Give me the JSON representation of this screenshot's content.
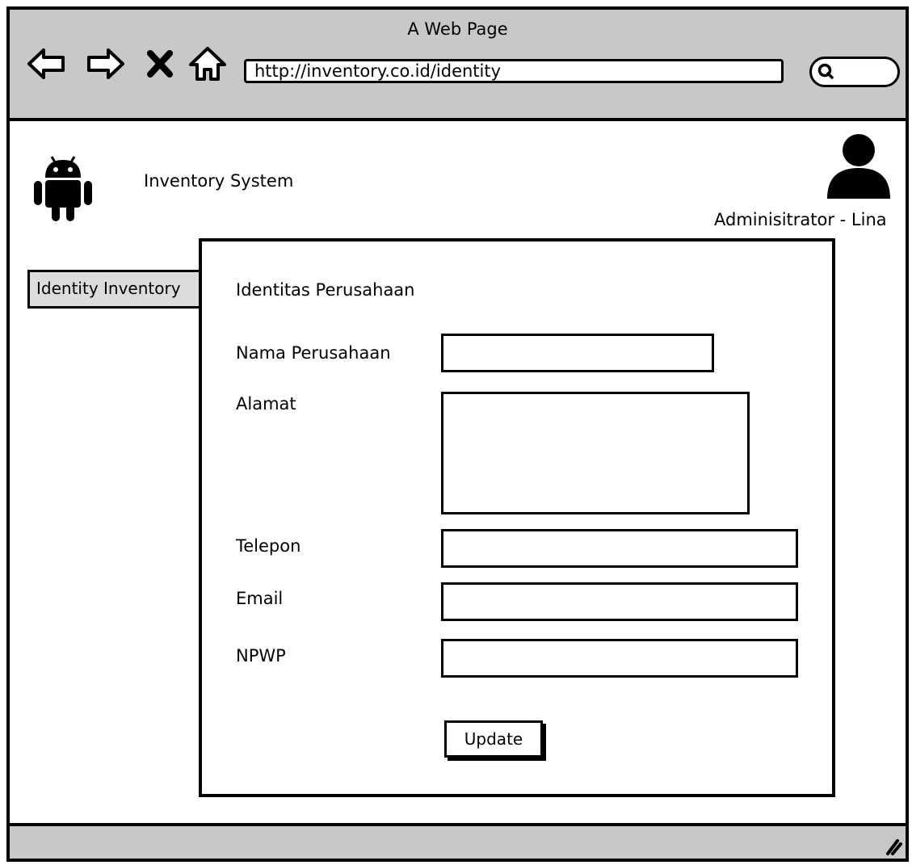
{
  "window": {
    "title": "A Web Page"
  },
  "browser": {
    "url": "http://inventory.co.id/identity",
    "back_icon": "back-arrow-icon",
    "forward_icon": "forward-arrow-icon",
    "stop_icon": "close-icon",
    "home_icon": "home-icon",
    "search_icon": "search-icon"
  },
  "header": {
    "app_name": "Inventory System",
    "logo_icon": "android-icon",
    "user_icon": "user-icon",
    "user_label": "Adminisitrator - Lina"
  },
  "sidebar": {
    "items": [
      {
        "label": "Identity Inventory"
      }
    ]
  },
  "form": {
    "title": "Identitas Perusahaan",
    "fields": [
      {
        "label": "Nama Perusahaan",
        "value": ""
      },
      {
        "label": "Alamat",
        "value": ""
      },
      {
        "label": "Telepon",
        "value": ""
      },
      {
        "label": "Email",
        "value": ""
      },
      {
        "label": "NPWP",
        "value": ""
      }
    ],
    "submit_label": "Update"
  }
}
